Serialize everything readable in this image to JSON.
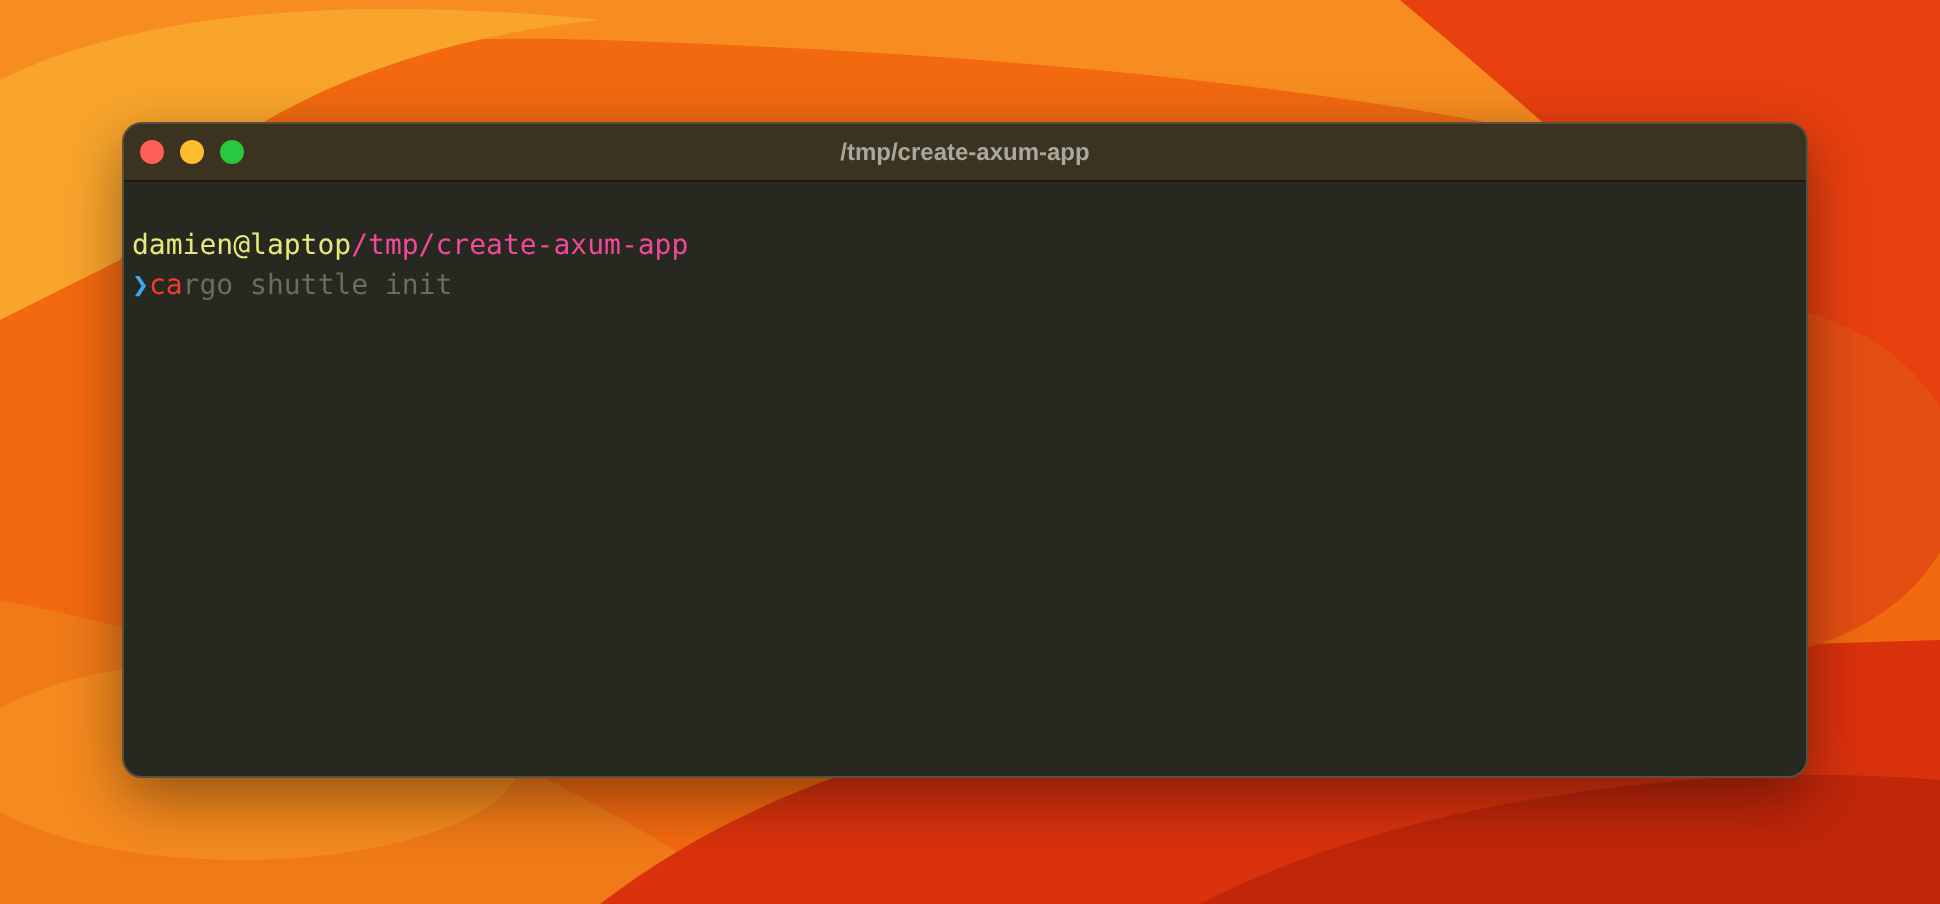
{
  "window": {
    "title": "/tmp/create-axum-app"
  },
  "terminal": {
    "prompt": {
      "user": "damien",
      "at": "@",
      "host": "laptop",
      "path": "/tmp/create-axum-app"
    },
    "command": {
      "symbol": "❯",
      "typed": "ca",
      "suggestion": "rgo shuttle init"
    }
  }
}
